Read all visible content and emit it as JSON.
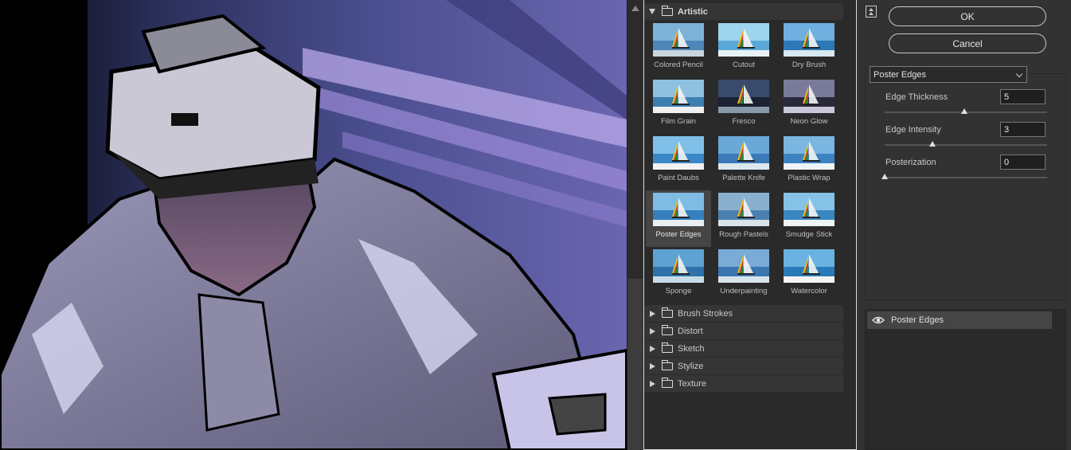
{
  "gallery": {
    "open_folder": {
      "label": "Artistic"
    },
    "thumbnails": [
      {
        "label": "Colored Pencil",
        "selected": false
      },
      {
        "label": "Cutout",
        "selected": false
      },
      {
        "label": "Dry Brush",
        "selected": false
      },
      {
        "label": "Film Grain",
        "selected": false
      },
      {
        "label": "Fresco",
        "selected": false
      },
      {
        "label": "Neon Glow",
        "selected": false
      },
      {
        "label": "Paint Daubs",
        "selected": false
      },
      {
        "label": "Palette Knife",
        "selected": false
      },
      {
        "label": "Plastic Wrap",
        "selected": false
      },
      {
        "label": "Poster Edges",
        "selected": true
      },
      {
        "label": "Rough Pastels",
        "selected": false
      },
      {
        "label": "Smudge Stick",
        "selected": false
      },
      {
        "label": "Sponge",
        "selected": false
      },
      {
        "label": "Underpainting",
        "selected": false
      },
      {
        "label": "Watercolor",
        "selected": false
      }
    ],
    "closed_folders": [
      {
        "label": "Brush Strokes"
      },
      {
        "label": "Distort"
      },
      {
        "label": "Sketch"
      },
      {
        "label": "Stylize"
      },
      {
        "label": "Texture"
      }
    ]
  },
  "dialog": {
    "ok_label": "OK",
    "cancel_label": "Cancel"
  },
  "settings": {
    "selected_filter": "Poster Edges",
    "params": [
      {
        "label": "Edge Thickness",
        "value": "5",
        "fraction": 0.5
      },
      {
        "label": "Edge Intensity",
        "value": "3",
        "fraction": 0.3
      },
      {
        "label": "Posterization",
        "value": "0",
        "fraction": 0.0
      }
    ]
  },
  "layers": {
    "items": [
      {
        "label": "Poster Edges",
        "visible": true
      }
    ]
  },
  "colors": {
    "accent_border": "#d9d9d9",
    "selected_bg": "#454545",
    "panel_bg": "#323232"
  }
}
